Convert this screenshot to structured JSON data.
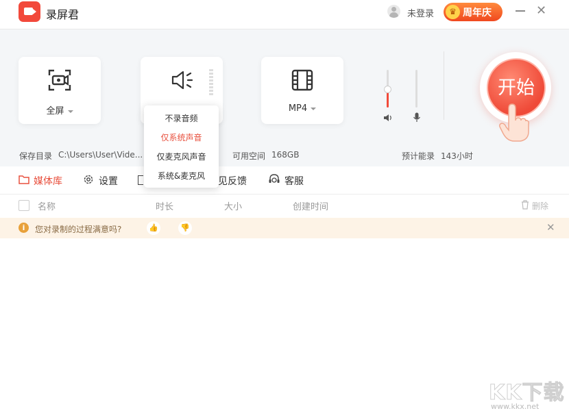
{
  "app": {
    "title": "录屏君"
  },
  "user": {
    "login_label": "未登录"
  },
  "promo": {
    "label": "周年庆",
    "crown": "♛"
  },
  "window": {
    "close": "✕"
  },
  "capture": {
    "screen_label": "全屏",
    "format_label": "MP4",
    "audio_options": [
      "不录音频",
      "仅系统声音",
      "仅麦克风声音",
      "系统&麦克风"
    ],
    "audio_selected": "仅系统声音",
    "system_volume_level": 0.5,
    "mic_volume_level": 0.0
  },
  "start": {
    "label": "开始"
  },
  "info": {
    "save_dir_label": "保存目录",
    "save_dir_value": "C:\\Users\\User\\Vide...",
    "free_space_label": "可用空间",
    "free_space_value": "168GB",
    "est_label": "预计能录",
    "est_value": "143小时"
  },
  "tabs": [
    {
      "label": "媒体库"
    },
    {
      "label": "设置"
    },
    {
      "label": "见反馈"
    },
    {
      "label": "客服"
    }
  ],
  "table": {
    "headers": [
      "名称",
      "时长",
      "大小",
      "创建时间"
    ],
    "delete_label": "删除"
  },
  "notice": {
    "icon": "i",
    "text": "您对录制的过程满意吗?",
    "thumb_up": "👍",
    "thumb_down": "👎",
    "close": "✕"
  },
  "watermark": {
    "text": "KK下载",
    "url": "www.kkx.net"
  },
  "colors": {
    "accent": "#e8503e",
    "start": "#ef4a38",
    "notice_bg": "#fdf3e6"
  }
}
